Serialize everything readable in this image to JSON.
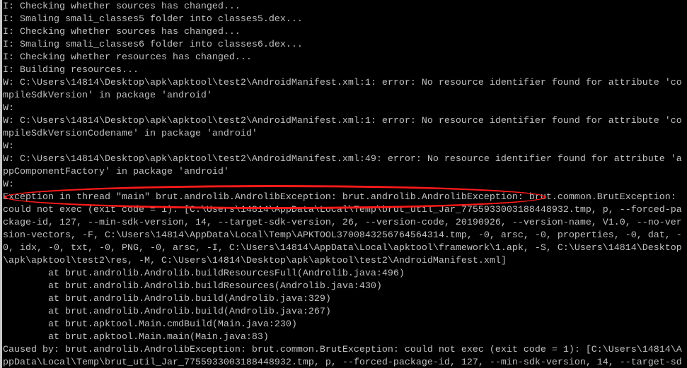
{
  "console": {
    "lines": [
      "I: Checking whether sources has changed...",
      "I: Smaling smali_classes5 folder into classes5.dex...",
      "I: Checking whether sources has changed...",
      "I: Smaling smali_classes6 folder into classes6.dex...",
      "I: Checking whether resources has changed...",
      "I: Building resources...",
      "W: C:\\Users\\14814\\Desktop\\apk\\apktool\\test2\\AndroidManifest.xml:1: error: No resource identifier found for attribute 'co",
      "mpileSdkVersion' in package 'android'",
      "W:",
      "W: C:\\Users\\14814\\Desktop\\apk\\apktool\\test2\\AndroidManifest.xml:1: error: No resource identifier found for attribute 'co",
      "mpileSdkVersionCodename' in package 'android'",
      "W:",
      "W: C:\\Users\\14814\\Desktop\\apk\\apktool\\test2\\AndroidManifest.xml:49: error: No resource identifier found for attribute 'a",
      "ppComponentFactory' in package 'android'",
      "W:",
      "Exception in thread \"main\" brut.androlib.AndrolibException: brut.androlib.AndrolibException: brut.common.BrutException:",
      "could not exec (exit code = 1): [C:\\Users\\14814\\AppData\\Local\\Temp\\brut_util_Jar_7755933003188448932.tmp, p, --forced-pa",
      "ckage-id, 127, --min-sdk-version, 14, --target-sdk-version, 26, --version-code, 20190926, --version-name, V1.0, --no-ver",
      "sion-vectors, -F, C:\\Users\\14814\\AppData\\Local\\Temp\\APKTOOL3700843256764564314.tmp, -0, arsc, -0, properties, -0, dat, -",
      "0, idx, -0, txt, -0, PNG, -0, arsc, -I, C:\\Users\\14814\\AppData\\Local\\apktool\\framework\\1.apk, -S, C:\\Users\\14814\\Desktop",
      "\\apk\\apktool\\test2\\res, -M, C:\\Users\\14814\\Desktop\\apk\\apktool\\test2\\AndroidManifest.xml]",
      "        at brut.androlib.Androlib.buildResourcesFull(Androlib.java:496)",
      "        at brut.androlib.Androlib.buildResources(Androlib.java:430)",
      "        at brut.androlib.Androlib.build(Androlib.java:329)",
      "        at brut.androlib.Androlib.build(Androlib.java:267)",
      "        at brut.apktool.Main.cmdBuild(Main.java:230)",
      "        at brut.apktool.Main.main(Main.java:83)",
      "Caused by: brut.androlib.AndrolibException: brut.common.BrutException: could not exec (exit code = 1): [C:\\Users\\14814\\A",
      "ppData\\Local\\Temp\\brut_util_Jar_7755933003188448932.tmp, p, --forced-package-id, 127, --min-sdk-version, 14, --target-sd"
    ]
  },
  "colors": {
    "background": "#000000",
    "text": "#c0c0c0",
    "annotation": "#ff1a1a"
  }
}
